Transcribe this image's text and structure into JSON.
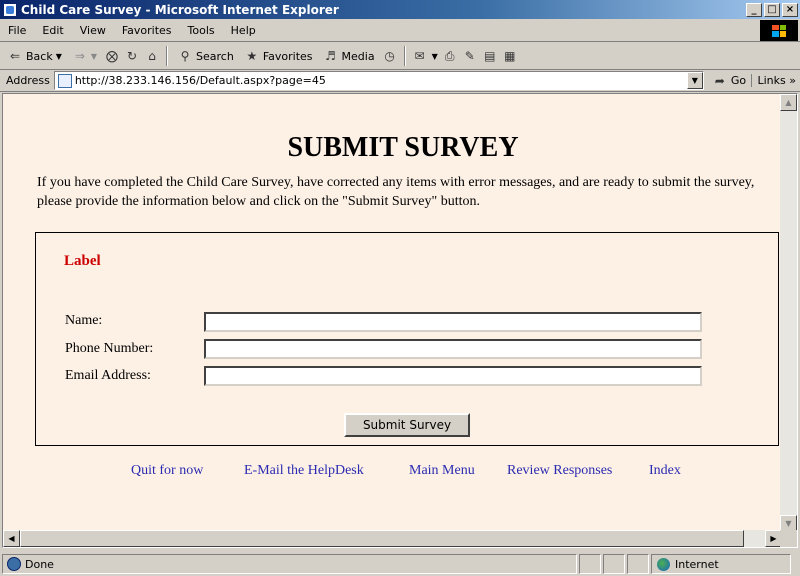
{
  "window": {
    "title": "Child Care Survey - Microsoft Internet Explorer",
    "controls": [
      "_",
      "□",
      "×"
    ]
  },
  "menu": [
    "File",
    "Edit",
    "View",
    "Favorites",
    "Tools",
    "Help"
  ],
  "toolbar": {
    "back": "Back",
    "search": "Search",
    "favorites": "Favorites",
    "media": "Media"
  },
  "address": {
    "label": "Address",
    "url": "http://38.233.146.156/Default.aspx?page=45",
    "go": "Go",
    "links": "Links"
  },
  "page": {
    "title": "SUBMIT SURVEY",
    "intro": "If you have completed the Child Care Survey, have corrected any items with error messages, and are ready to submit the survey, please provide the information below and click on the \"Submit Survey\" button.",
    "form_label": "Label",
    "fields": [
      {
        "label": "Name:",
        "value": ""
      },
      {
        "label": "Phone Number:",
        "value": ""
      },
      {
        "label": "Email Address:",
        "value": ""
      }
    ],
    "submit": "Submit Survey",
    "links": [
      "Quit for now",
      "E-Mail the HelpDesk",
      "Main Menu",
      "Review Responses",
      "Index"
    ]
  },
  "status": {
    "text": "Done",
    "zone": "Internet"
  },
  "colors": {
    "page_bg": "#fdf1e6",
    "label_red": "#cc0000",
    "link_blue": "#2b2bb0"
  }
}
